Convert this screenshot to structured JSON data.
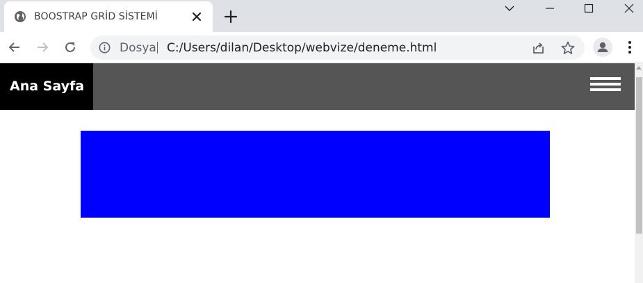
{
  "browser": {
    "tab": {
      "title": "BOOSTRAP GRİD SİSTEMİ",
      "favicon": "globe-icon"
    },
    "window_controls": [
      "chevron-down-icon",
      "minimize-icon",
      "maximize-icon",
      "close-icon"
    ],
    "toolbar": {
      "scheme_label": "Dosya",
      "url": "C:/Users/dilan/Desktop/webvize/deneme.html",
      "icons": [
        "back-icon",
        "forward-icon",
        "reload-icon",
        "info-icon",
        "share-icon",
        "star-icon",
        "profile-icon",
        "more-icon"
      ]
    }
  },
  "page": {
    "navbar": {
      "brand": "Ana Sayfa",
      "background": "#555555",
      "brand_background": "#000000",
      "toggle_icon": "hamburger-icon"
    },
    "content": {
      "box_color": "#0000ff"
    }
  }
}
